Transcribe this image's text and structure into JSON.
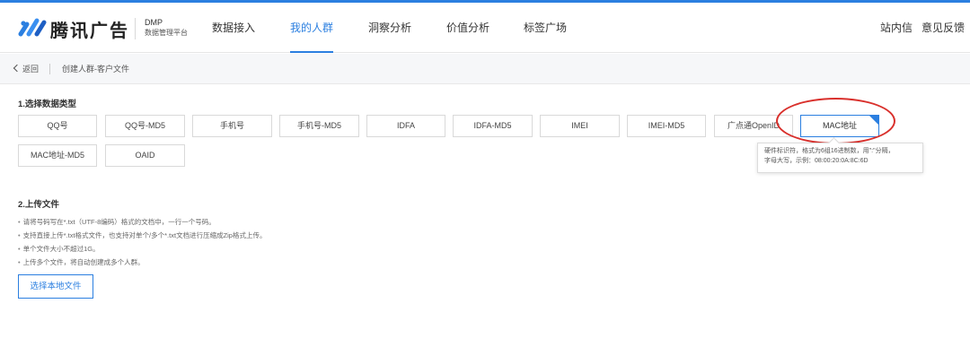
{
  "header": {
    "logo_text": "腾讯广告",
    "product_name": "DMP",
    "product_subtitle": "数据管理平台",
    "nav": [
      {
        "label": "数据接入",
        "active": false
      },
      {
        "label": "我的人群",
        "active": true
      },
      {
        "label": "洞察分析",
        "active": false
      },
      {
        "label": "价值分析",
        "active": false
      },
      {
        "label": "标签广场",
        "active": false
      }
    ],
    "right_links": [
      "站内信",
      "意见反馈"
    ]
  },
  "subbar": {
    "back_label": "返回",
    "breadcrumb": "创建人群-客户文件"
  },
  "section1": {
    "title": "1.选择数据类型",
    "types": [
      {
        "label": "QQ号",
        "selected": false
      },
      {
        "label": "QQ号-MD5",
        "selected": false
      },
      {
        "label": "手机号",
        "selected": false
      },
      {
        "label": "手机号-MD5",
        "selected": false
      },
      {
        "label": "IDFA",
        "selected": false
      },
      {
        "label": "IDFA-MD5",
        "selected": false
      },
      {
        "label": "IMEI",
        "selected": false
      },
      {
        "label": "IMEI-MD5",
        "selected": false
      },
      {
        "label": "广点通OpenID",
        "selected": false
      },
      {
        "label": "MAC地址",
        "selected": true
      },
      {
        "label": "MAC地址-MD5",
        "selected": false
      },
      {
        "label": "OAID",
        "selected": false
      }
    ],
    "tooltip_line1": "硬件标识符，格式为6组16进制数，用\":\"分隔，",
    "tooltip_line2": "字母大写，示例：08:00:20:0A:8C:6D"
  },
  "section2": {
    "title": "2.上传文件",
    "rules": [
      "请将号码写在*.txt（UTF-8编码）格式的文档中，一行一个号码。",
      "支持直接上传*.txt格式文件，也支持对单个/多个*.txt文档进行压缩成Zip格式上传。",
      "单个文件大小不超过1G。",
      "上传多个文件，将自动创建成多个人群。"
    ],
    "upload_button": "选择本地文件"
  },
  "colors": {
    "accent": "#2b7fe0",
    "highlight": "#d9302c"
  }
}
